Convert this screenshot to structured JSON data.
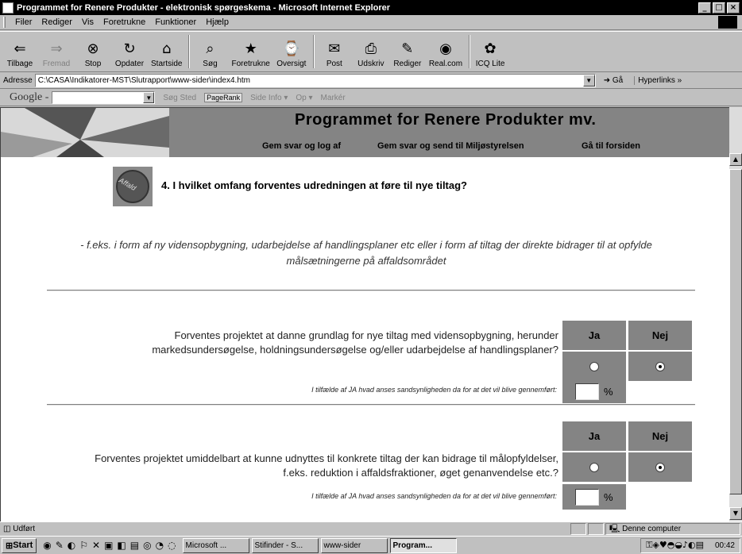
{
  "window": {
    "title": "Programmet for Renere Produkter - elektronisk spørgeskema - Microsoft Internet Explorer",
    "controls": [
      "_",
      "□",
      "×"
    ]
  },
  "menu": [
    "Filer",
    "Rediger",
    "Vis",
    "Foretrukne",
    "Funktioner",
    "Hjælp"
  ],
  "toolbar": [
    {
      "label": "Tilbage",
      "icon": "⇐",
      "disabled": false
    },
    {
      "label": "Fremad",
      "icon": "⇒",
      "disabled": true
    },
    {
      "label": "Stop",
      "icon": "⊗",
      "disabled": false
    },
    {
      "label": "Opdater",
      "icon": "↻",
      "disabled": false
    },
    {
      "label": "Startside",
      "icon": "⌂",
      "disabled": false
    },
    {
      "label": "Søg",
      "icon": "⌕",
      "disabled": false
    },
    {
      "label": "Foretrukne",
      "icon": "★",
      "disabled": false
    },
    {
      "label": "Oversigt",
      "icon": "⌚",
      "disabled": false
    },
    {
      "label": "Post",
      "icon": "✉",
      "disabled": false
    },
    {
      "label": "Udskriv",
      "icon": "⎙",
      "disabled": false
    },
    {
      "label": "Rediger",
      "icon": "✎",
      "disabled": false
    },
    {
      "label": "Real.com",
      "icon": "◉",
      "disabled": false
    },
    {
      "label": "ICQ Lite",
      "icon": "✿",
      "disabled": false
    }
  ],
  "address": {
    "label": "Adresse",
    "value": "C:\\CASA\\Indikatorer-MST\\Slutrapport\\www-sider\\index4.htm",
    "go": "Gå",
    "links": "Hyperlinks »"
  },
  "google": {
    "logo": "Google -",
    "items": [
      "Søg Sted",
      "PageRank",
      "Side Info ▾",
      "Op ▾",
      "Markér"
    ]
  },
  "page": {
    "banner_title": "Programmet for Renere Produkter mv.",
    "nav": [
      "Gem svar og log af",
      "Gem svar og send til Miljøstyrelsen",
      "Gå til forsiden"
    ],
    "logo_text": "Affald",
    "question": "4. I hvilket omfang forventes udredningen at føre til nye tiltag?",
    "example_line1": "- f.eks. i form af ny vidensopbygning, udarbejdelse af handlingsplaner etc eller i form af tiltag der direkte bidrager til at opfylde",
    "example_line2": "målsætningerne på affaldsområdet",
    "col_yes": "Ja",
    "col_no": "Nej",
    "q1_line1": "Forventes projektet at danne grundlag for nye tiltag med vidensopbygning, herunder",
    "q1_line2": "markedsundersøgelse, holdningsundersøgelse og/eller udarbejdelse af handlingsplaner?",
    "q1_answer": "Nej",
    "q2_line1": "Forventes projektet umiddelbart at kunne udnyttes til konkrete tiltag der kan bidrage til målopfyldelser,",
    "q2_line2": "f.eks. reduktion i affaldsfraktioner, øget genanvendelse etc.?",
    "q2_answer": "Nej",
    "prob_text": "I tilfælde af JA hvad anses sandsynligheden da for at det vil blive gennemført:",
    "percent": "%"
  },
  "status": {
    "text": "Udført",
    "zone": "Denne computer"
  },
  "taskbar": {
    "start": "Start",
    "tasks": [
      "Microsoft ...",
      "Stifinder - S...",
      "www-sider",
      "Program..."
    ],
    "time": "00:42"
  }
}
